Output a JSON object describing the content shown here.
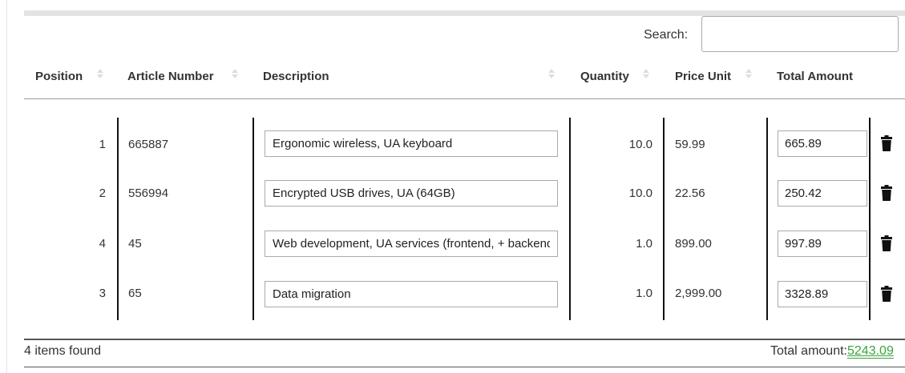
{
  "search": {
    "label": "Search:",
    "value": "",
    "placeholder": ""
  },
  "columns": {
    "position": "Position",
    "article_number": "Article Number",
    "description": "Description",
    "quantity": "Quantity",
    "price_unit": "Price Unit",
    "total_amount": "Total Amount"
  },
  "rows": [
    {
      "position": "1",
      "article_number": "665887",
      "description": "Ergonomic wireless, UA keyboard",
      "quantity": "10.0",
      "price_unit": "59.99",
      "total_amount": "665.89"
    },
    {
      "position": "2",
      "article_number": "556994",
      "description": "Encrypted USB drives, UA (64GB)",
      "quantity": "10.0",
      "price_unit": "22.56",
      "total_amount": "250.42"
    },
    {
      "position": "4",
      "article_number": "45",
      "description": "Web development, UA services (frontend, + backend)",
      "quantity": "1.0",
      "price_unit": "899.00",
      "total_amount": "997.89"
    },
    {
      "position": "3",
      "article_number": "65",
      "description": "Data migration",
      "quantity": "1.0",
      "price_unit": "2,999.00",
      "total_amount": "3328.89"
    }
  ],
  "footer": {
    "items_found": "4 items found",
    "total_label": "Total amount:",
    "total_value": "5243.09"
  },
  "colors": {
    "total_value": "#3aa33a",
    "header_text": "#333333"
  },
  "icons": {
    "delete": "trash-icon",
    "sort": "sort-icon"
  }
}
